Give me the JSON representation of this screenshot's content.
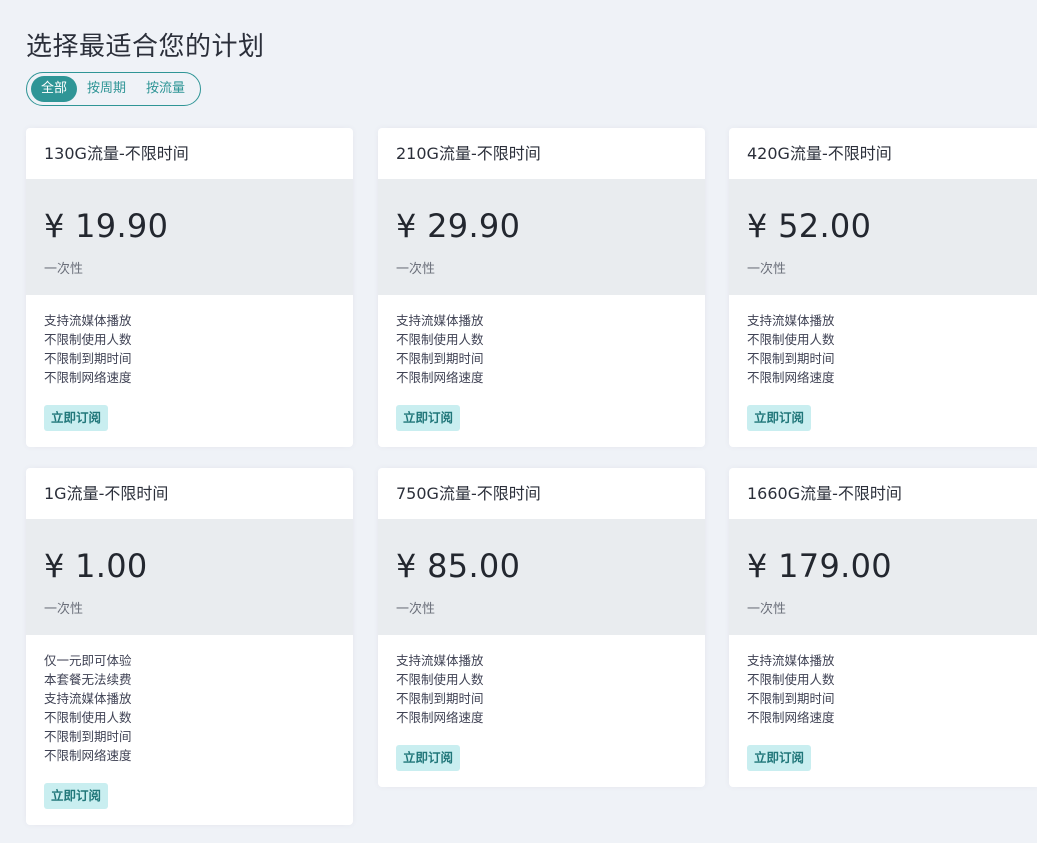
{
  "page_title": "选择最适合您的计划",
  "filter_tabs": [
    {
      "label": "全部",
      "active": true
    },
    {
      "label": "按周期",
      "active": false
    },
    {
      "label": "按流量",
      "active": false
    }
  ],
  "plans": [
    {
      "name": "130G流量-不限时间",
      "price": "¥ 19.90",
      "period": "一次性",
      "features": [
        "支持流媒体播放",
        "不限制使用人数",
        "不限制到期时间",
        "不限制网络速度"
      ],
      "button": "立即订阅"
    },
    {
      "name": "210G流量-不限时间",
      "price": "¥ 29.90",
      "period": "一次性",
      "features": [
        "支持流媒体播放",
        "不限制使用人数",
        "不限制到期时间",
        "不限制网络速度"
      ],
      "button": "立即订阅"
    },
    {
      "name": "420G流量-不限时间",
      "price": "¥ 52.00",
      "period": "一次性",
      "features": [
        "支持流媒体播放",
        "不限制使用人数",
        "不限制到期时间",
        "不限制网络速度"
      ],
      "button": "立即订阅"
    },
    {
      "name": "1G流量-不限时间",
      "price": "¥ 1.00",
      "period": "一次性",
      "features": [
        "仅一元即可体验",
        "本套餐无法续费",
        "支持流媒体播放",
        "不限制使用人数",
        "不限制到期时间",
        "不限制网络速度"
      ],
      "button": "立即订阅"
    },
    {
      "name": "750G流量-不限时间",
      "price": "¥ 85.00",
      "period": "一次性",
      "features": [
        "支持流媒体播放",
        "不限制使用人数",
        "不限制到期时间",
        "不限制网络速度"
      ],
      "button": "立即订阅"
    },
    {
      "name": "1660G流量-不限时间",
      "price": "¥ 179.00",
      "period": "一次性",
      "features": [
        "支持流媒体播放",
        "不限制使用人数",
        "不限制到期时间",
        "不限制网络速度"
      ],
      "button": "立即订阅"
    }
  ],
  "colors": {
    "accent": "#2f9596",
    "page_background": "#eff2f7",
    "price_block": "#e9ecef",
    "button_background": "#c9eef0",
    "button_text": "#21777a"
  }
}
